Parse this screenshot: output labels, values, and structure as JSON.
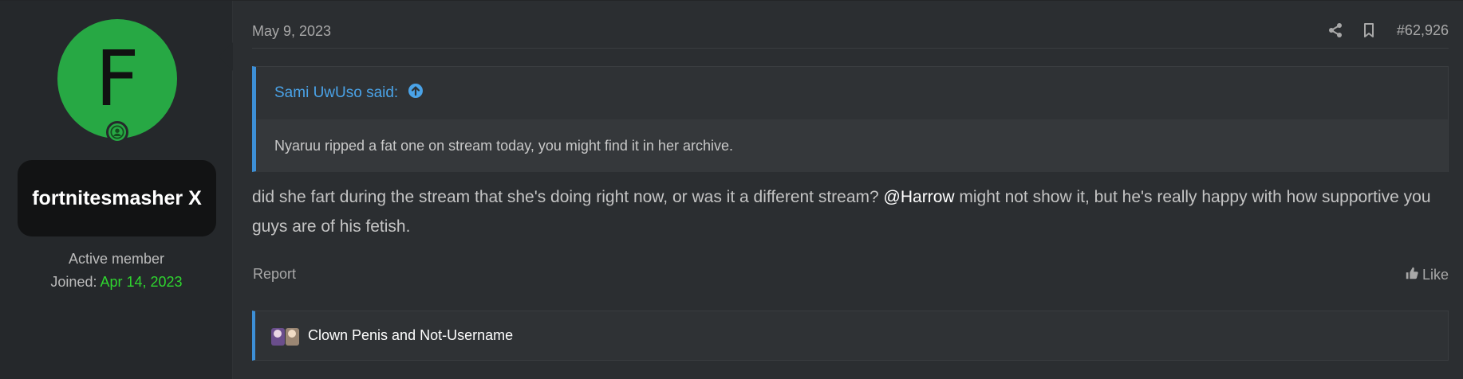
{
  "user": {
    "avatar_letter": "F",
    "username": "fortnitesmasher X",
    "title": "Active member",
    "joined_label": "Joined:",
    "joined_date": "Apr 14, 2023"
  },
  "post": {
    "date": "May 9, 2023",
    "number": "#62,926",
    "quote": {
      "author": "Sami UwUso said:",
      "text": "Nyaruu ripped a fat one on stream today, you might find it in her archive."
    },
    "message_part1": "did she fart during the stream that she's doing right now, or was it a different stream? ",
    "mention": "@Harrow",
    "message_part2": " might not show it, but he's really happy with how supportive you guys are of his fetish.",
    "report_label": "Report",
    "like_label": "Like",
    "signature_text": "Clown Penis and Not-Username"
  },
  "colors": {
    "avatar_bg": "#27a844",
    "joined_date": "#2fd52f",
    "quote_accent": "#3d8fd6",
    "quote_author": "#4aa3e8"
  },
  "icons": [
    "online-status-icon",
    "share-icon",
    "bookmark-icon",
    "quote-jump-icon",
    "thumbs-up-icon",
    "signature-image"
  ]
}
